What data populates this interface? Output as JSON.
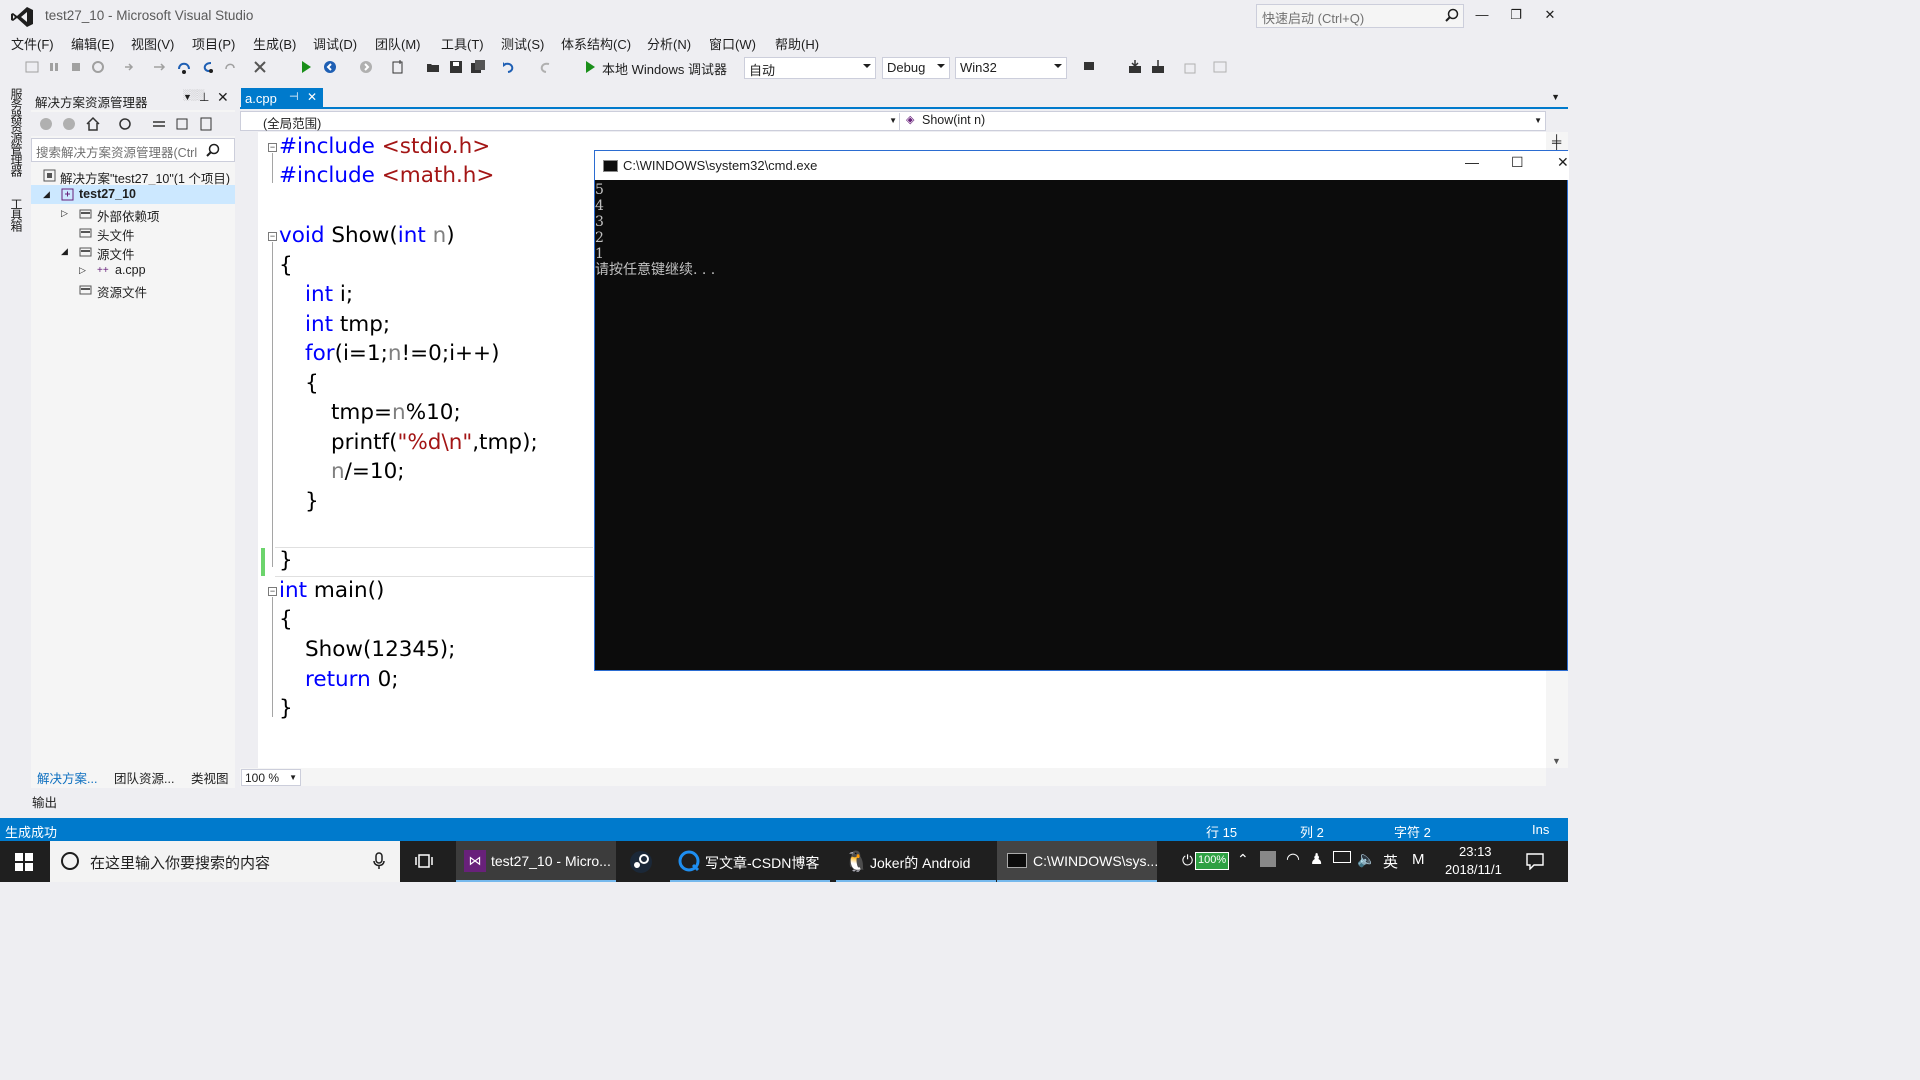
{
  "window": {
    "title": "test27_10 - Microsoft Visual Studio",
    "quick_launch_placeholder": "快速启动 (Ctrl+Q)"
  },
  "menu": [
    "文件(F)",
    "编辑(E)",
    "视图(V)",
    "项目(P)",
    "生成(B)",
    "调试(D)",
    "团队(M)",
    "工具(T)",
    "测试(S)",
    "体系结构(C)",
    "分析(N)",
    "窗口(W)",
    "帮助(H)"
  ],
  "toolbar": {
    "run_label": "本地 Windows 调试器",
    "solution_config_auto": "自动",
    "configuration": "Debug",
    "platform": "Win32"
  },
  "left_strip": {
    "server_explorer": "服务器资源管理器",
    "toolbox": "工具箱"
  },
  "solution_explorer": {
    "title": "解决方案资源管理器",
    "search_placeholder": "搜索解决方案资源管理器(Ctrl",
    "tree": [
      {
        "label": "解决方案\"test27_10\"(1 个项目)",
        "icon": "solution-icon"
      },
      {
        "label": "test27_10",
        "icon": "project-icon"
      },
      {
        "label": "外部依赖项",
        "icon": "folder-icon"
      },
      {
        "label": "头文件",
        "icon": "folder-icon"
      },
      {
        "label": "源文件",
        "icon": "folder-icon"
      },
      {
        "label": "a.cpp",
        "icon": "cpp-file-icon"
      },
      {
        "label": "资源文件",
        "icon": "folder-icon"
      }
    ],
    "tabs": [
      "解决方案...",
      "团队资源...",
      "类视图"
    ]
  },
  "output_label": "输出",
  "editor": {
    "tab": "a.cpp",
    "scope": "(全局范围)",
    "function": "Show(int n)",
    "zoom": "100 %"
  },
  "code": {
    "l1_pp": "#include",
    "l1_hdr": "<stdio.h>",
    "l2_pp": "#include",
    "l2_hdr": "<math.h>",
    "l4_void": "void",
    "l4_name": "Show(",
    "l4_int": "int",
    "l4_n": "n",
    "l4_close": ")",
    "l5": "{",
    "l6_int": "int",
    "l6_rest": "i;",
    "l7_int": "int",
    "l7_rest": "tmp;",
    "l8_for": "for",
    "l8_a": "(i=1;",
    "l8_n": "n",
    "l8_b": "!=0;i++)",
    "l9": "{",
    "l10_a": "tmp=",
    "l10_n": "n",
    "l10_b": "%10;",
    "l11_a": "printf(",
    "l11_str": "\"%d\\n\"",
    "l11_b": ",tmp);",
    "l12_n": "n",
    "l12_b": "/=10;",
    "l13": "}",
    "l15": "}",
    "l16_int": "int",
    "l16_rest": "main()",
    "l17": "{",
    "l18": "Show(12345);",
    "l19_ret": "return",
    "l19_rest": "0;",
    "l20": "}"
  },
  "console": {
    "title": "C:\\WINDOWS\\system32\\cmd.exe",
    "lines": [
      "5",
      "4",
      "3",
      "2",
      "1",
      "请按任意键继续. . ."
    ]
  },
  "statusbar": {
    "message": "生成成功",
    "line": "行 15",
    "col": "列 2",
    "char": "字符 2",
    "mode": "Ins"
  },
  "taskbar": {
    "search_placeholder": "在这里输入你要搜索的内容",
    "apps": [
      "test27_10 - Micro...",
      "写文章-CSDN博客",
      "Joker的 Android",
      "C:\\WINDOWS\\sys..."
    ],
    "battery": "100%",
    "ime": "英",
    "ime2": "M",
    "time": "23:13",
    "date": "2018/11/1"
  },
  "colors": {
    "accent": "#007acc",
    "keyword": "#0000ff",
    "string": "#a31515",
    "param": "#808080"
  }
}
